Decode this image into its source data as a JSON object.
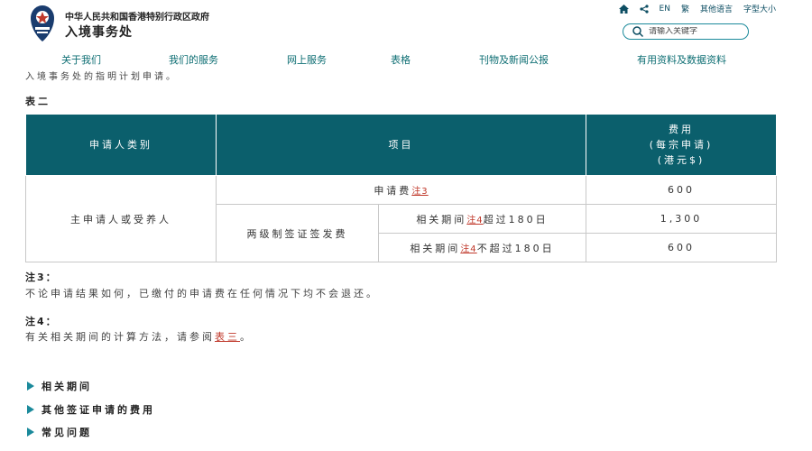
{
  "header": {
    "org_sub": "中华人民共和国香港特别行政区政府",
    "org_main": "入境事务处",
    "top_links": {
      "home_icon": "home-icon",
      "share_icon": "share-icon",
      "en": "EN",
      "trad": "繁",
      "other_lang": "其他语言",
      "font_size": "字型大小"
    },
    "search": {
      "placeholder": "请输入关键字",
      "icon": "search-icon"
    }
  },
  "nav": {
    "items": [
      "关于我们",
      "我们的服务",
      "网上服务",
      "表格",
      "刊物及新闻公报",
      "有用资料及数据资料"
    ]
  },
  "main": {
    "intro": "入境事务处的指明计划申请。",
    "table_title": "表二",
    "table": {
      "headers": {
        "category": "申请人类别",
        "item": "项目",
        "fee_line1": "费用",
        "fee_line2": "(每宗申请)",
        "fee_line3": "(港元$)"
      },
      "category": "主申请人或受养人",
      "rows": {
        "application_fee": {
          "label": "申请费",
          "note": "注3",
          "value": "600"
        },
        "visa_fee_label": "两级制签证签发费",
        "over": {
          "prefix": "相关期间",
          "note": "注4",
          "suffix": "超过180日",
          "value": "1,300"
        },
        "not_over": {
          "prefix": "相关期间",
          "note": "注4",
          "suffix": "不超过180日",
          "value": "600"
        }
      }
    },
    "notes": {
      "note3_title": "注3：",
      "note3_text": "不论申请结果如何，已缴付的申请费在任何情况下均不会退还。",
      "note4_title": "注4：",
      "note4_prefix": "有关相关期间的计算方法，请参阅",
      "note4_link": "表三",
      "note4_suffix": "。"
    },
    "expanders": [
      "相关期间",
      "其他签证申请的费用",
      "常见问题"
    ]
  },
  "colors": {
    "teal": "#0b5f6c",
    "nav_text": "#0d6e73",
    "link_red": "#c0392b",
    "accent": "#1b8a9b"
  }
}
